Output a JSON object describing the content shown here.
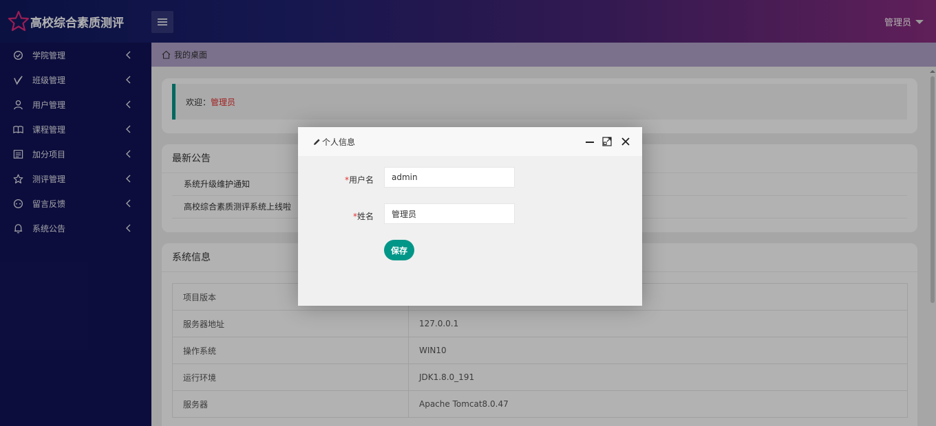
{
  "header": {
    "app_title": "高校综合素质测评",
    "user_label": "管理员"
  },
  "sidebar": {
    "items": [
      {
        "label": "学院管理",
        "icon": "check-circle-icon"
      },
      {
        "label": "班级管理",
        "icon": "leaf-icon"
      },
      {
        "label": "用户管理",
        "icon": "user-icon"
      },
      {
        "label": "课程管理",
        "icon": "book-icon"
      },
      {
        "label": "加分项目",
        "icon": "list-icon"
      },
      {
        "label": "测评管理",
        "icon": "star-icon"
      },
      {
        "label": "留言反馈",
        "icon": "message-icon"
      },
      {
        "label": "系统公告",
        "icon": "bell-icon"
      }
    ]
  },
  "breadcrumb": {
    "label": "我的桌面"
  },
  "welcome": {
    "prefix": "欢迎：",
    "name": "管理员"
  },
  "notices": {
    "title": "最新公告",
    "items": [
      "系统升级维护通知",
      "高校综合素质测评系统上线啦"
    ]
  },
  "sysinfo": {
    "title": "系统信息",
    "rows": [
      {
        "key": "项目版本",
        "value": ""
      },
      {
        "key": "服务器地址",
        "value": "127.0.0.1"
      },
      {
        "key": "操作系统",
        "value": "WIN10"
      },
      {
        "key": "运行环境",
        "value": "JDK1.8.0_191"
      },
      {
        "key": "服务器",
        "value": "Apache Tomcat8.0.47"
      }
    ]
  },
  "modal": {
    "title": "个人信息",
    "required_mark": "*",
    "username_label": "用户名",
    "username_value": "admin",
    "name_label": "姓名",
    "name_value": "管理员",
    "save_label": "保存"
  },
  "colors": {
    "accent": "#009688",
    "sidebar_bg": "#121457",
    "required": "#e63030"
  }
}
